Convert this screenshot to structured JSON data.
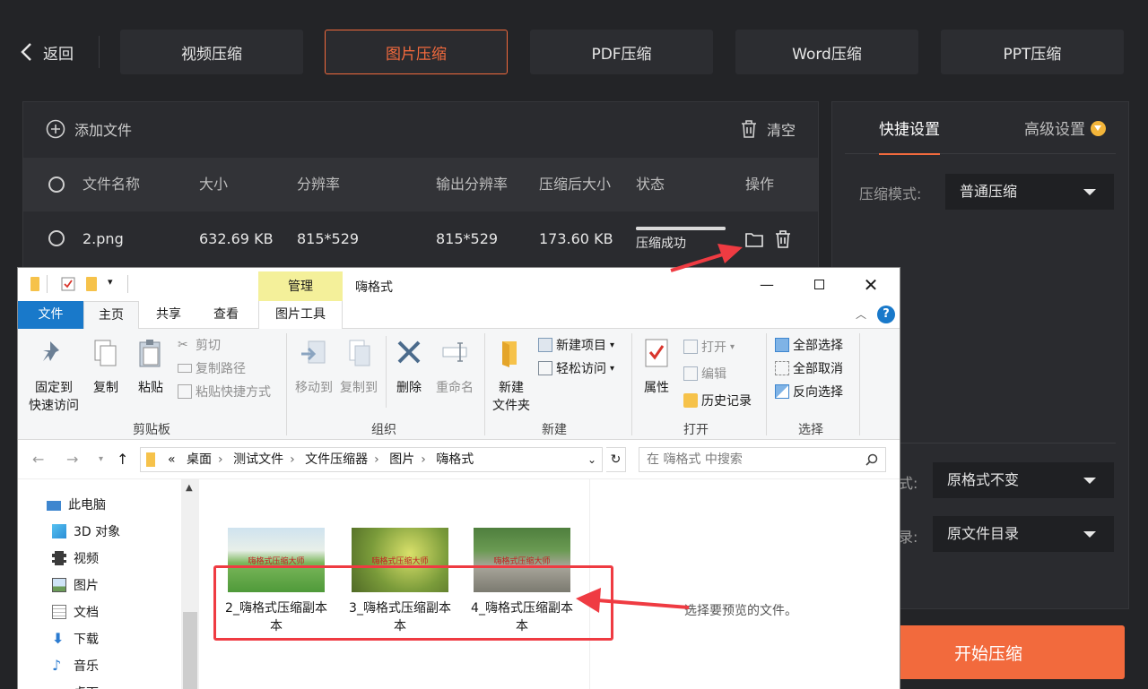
{
  "nav": {
    "back_label": "返回",
    "tabs": [
      "视频压缩",
      "图片压缩",
      "PDF压缩",
      "Word压缩",
      "PPT压缩"
    ],
    "active_index": 1
  },
  "file_panel": {
    "add_file_label": "添加文件",
    "clear_label": "清空",
    "columns": [
      "文件名称",
      "大小",
      "分辨率",
      "输出分辨率",
      "压缩后大小",
      "状态",
      "操作"
    ],
    "rows": [
      {
        "name": "2.png",
        "size": "632.69 KB",
        "resolution": "815*529",
        "output_resolution": "815*529",
        "compressed_size": "173.60 KB",
        "status": "压缩成功",
        "progress": 1.0
      }
    ]
  },
  "settings": {
    "tabs": [
      "快捷设置",
      "高级设置"
    ],
    "active_tab": 0,
    "mode_label": "压缩模式:",
    "mode_value": "普通压缩",
    "format_label_visible": "式:",
    "format_value": "原格式不变",
    "output_label_visible": "录:",
    "output_value": "原文件目录"
  },
  "start_button": "开始压缩",
  "explorer": {
    "title": "嗨格式",
    "manage_tab": "管理",
    "picture_tools_tab": "图片工具",
    "ribbon_tabs": [
      "文件",
      "主页",
      "共享",
      "查看"
    ],
    "clipboard": {
      "group": "剪贴板",
      "pin": "固定到\n快速访问",
      "copy": "复制",
      "paste": "粘贴",
      "cut": "剪切",
      "copy_path": "复制路径",
      "paste_shortcut": "粘贴快捷方式"
    },
    "organize": {
      "group": "组织",
      "move_to": "移动到",
      "copy_to": "复制到",
      "delete": "删除",
      "rename": "重命名"
    },
    "new": {
      "group": "新建",
      "new_folder": "新建\n文件夹",
      "new_item": "新建项目",
      "easy_access": "轻松访问"
    },
    "open": {
      "group": "打开",
      "properties": "属性",
      "open": "打开",
      "edit": "编辑",
      "history": "历史记录"
    },
    "select": {
      "group": "选择",
      "select_all": "全部选择",
      "select_none": "全部取消",
      "invert": "反向选择"
    },
    "address": {
      "prefix": "«",
      "crumbs": [
        "桌面",
        "测试文件",
        "文件压缩器",
        "图片",
        "嗨格式"
      ]
    },
    "search_placeholder": "在 嗨格式 中搜索",
    "nav_items": [
      "此电脑",
      "3D 对象",
      "视频",
      "图片",
      "文档",
      "下载",
      "音乐",
      "桌面"
    ],
    "files": [
      {
        "name": "2_嗨格式压缩副本",
        "caption": "嗨格式压缩大师"
      },
      {
        "name": "3_嗨格式压缩副本",
        "caption": "嗨格式压缩大师"
      },
      {
        "name": "4_嗨格式压缩副本",
        "caption": "嗨格式压缩大师"
      }
    ],
    "file_name_suffix": "本",
    "preview_text": "选择要预览的文件。"
  }
}
